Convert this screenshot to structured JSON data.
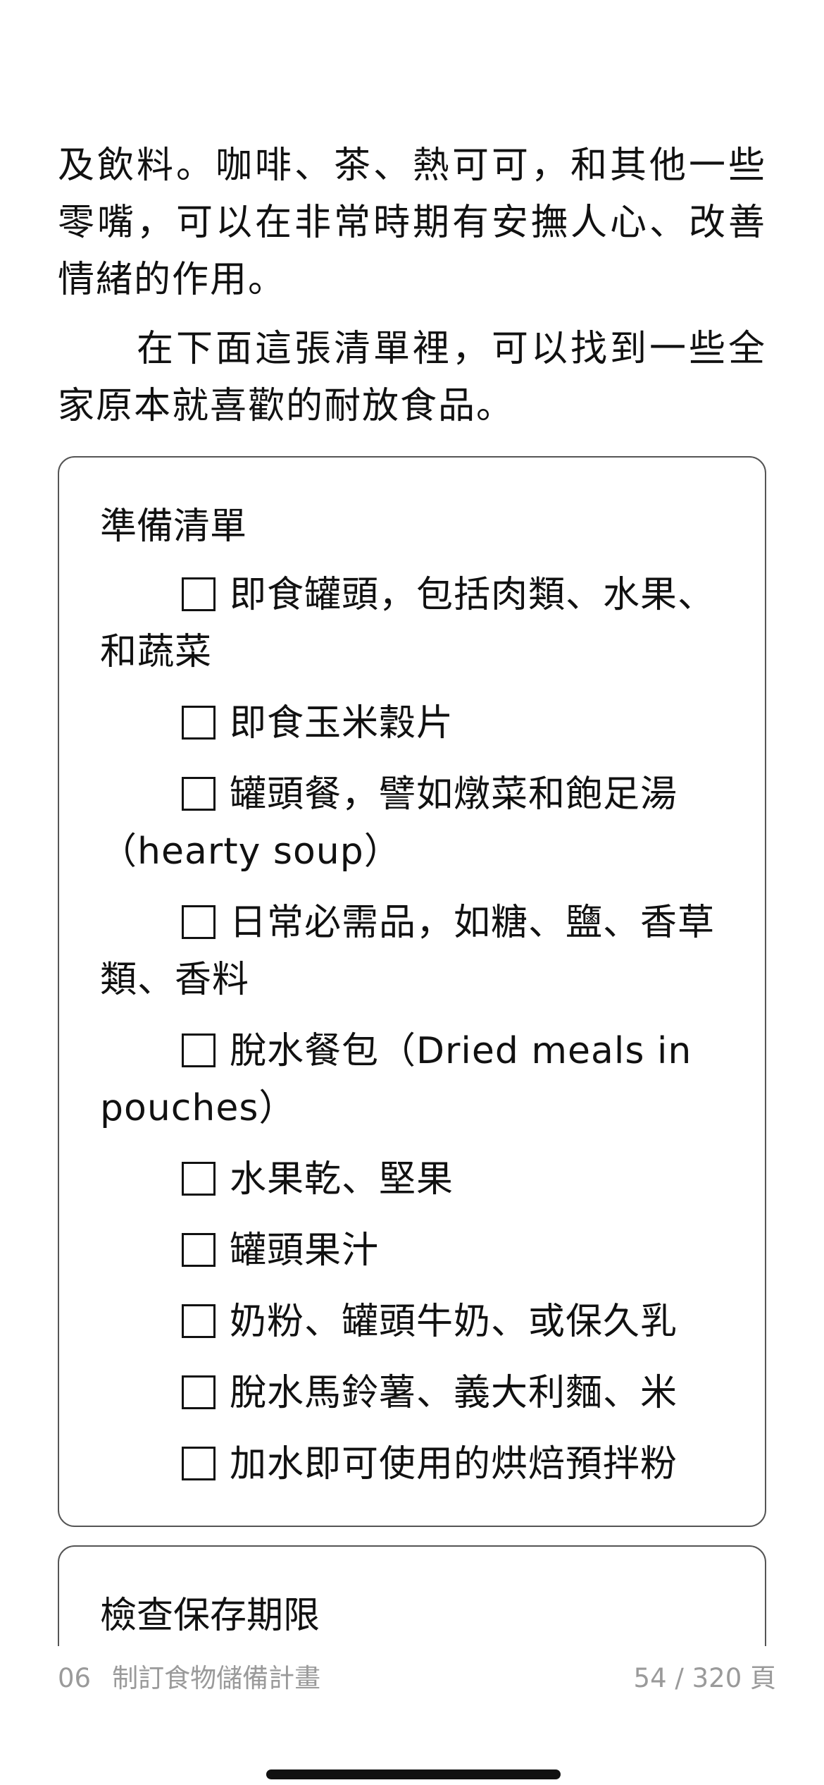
{
  "body": {
    "paragraph1": "及飲料。咖啡、茶、熱可可，和其他一些零嘴，可以在非常時期有安撫人心、改善情緒的作用。",
    "paragraph2": "在下面這張清單裡，可以找到一些全家原本就喜歡的耐放食品。"
  },
  "checklist": {
    "title": "準備清單",
    "items": [
      {
        "label": "即食罐頭，包括肉類、水果、和蔬菜"
      },
      {
        "label": "即食玉米穀片"
      },
      {
        "label": "罐頭餐，譬如燉菜和飽足湯（hearty soup）"
      },
      {
        "label": "日常必需品，如糖、鹽、香草類、香料"
      },
      {
        "label": "脫水餐包（Dried meals in pouches）"
      },
      {
        "label": "水果乾、堅果"
      },
      {
        "label": "罐頭果汁"
      },
      {
        "label": "奶粉、罐頭牛奶、或保久乳"
      },
      {
        "label": "脫水馬鈴薯、義大利麵、米"
      },
      {
        "label": "加水即可使用的烘焙預拌粉"
      }
    ]
  },
  "next_box": {
    "title": "檢查保存期限"
  },
  "footer": {
    "chapter_number": "06",
    "chapter_title": "制訂食物儲備計畫",
    "page_indicator": "54 / 320 頁"
  }
}
